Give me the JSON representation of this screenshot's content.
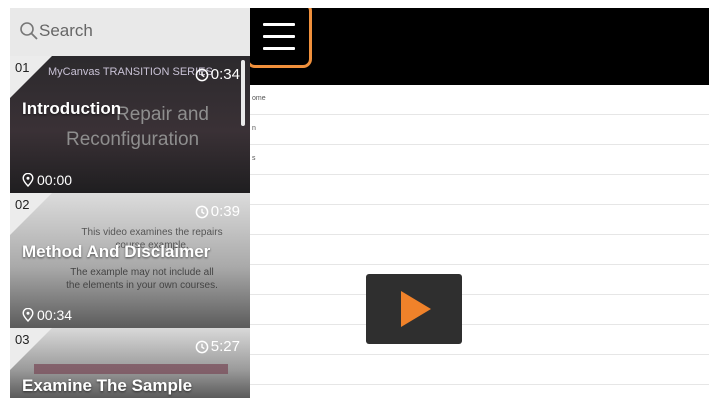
{
  "search": {
    "placeholder": "Search"
  },
  "player": {
    "background_rows": [
      "ome",
      "n",
      "s",
      "",
      "",
      "",
      "",
      "",
      "",
      ""
    ]
  },
  "lessons": [
    {
      "number": "01",
      "duration": "0:34",
      "title": "Introduction",
      "timestamp": "00:00",
      "thumbnail_text": [
        "MyCanvas TRANSITION SERIES",
        "Repair and",
        "Reconfiguration"
      ]
    },
    {
      "number": "02",
      "duration": "0:39",
      "title": "Method And Disclaimer",
      "timestamp": "00:34",
      "thumbnail_text": [
        "This video examines the repairs",
        "course example.",
        "The example may not include all",
        "the elements in your own courses."
      ]
    },
    {
      "number": "03",
      "duration": "5:27",
      "title": "Examine The Sample",
      "timestamp": "",
      "thumbnail_text": []
    }
  ],
  "colors": {
    "accent": "#f0822a",
    "highlight_border": "#f0903c",
    "sidebar_bg": "#3b3b3b"
  },
  "icons": {
    "search": "search-icon",
    "menu": "hamburger-menu-icon",
    "clock": "clock-icon",
    "pin": "location-pin-icon",
    "play": "play-icon"
  }
}
